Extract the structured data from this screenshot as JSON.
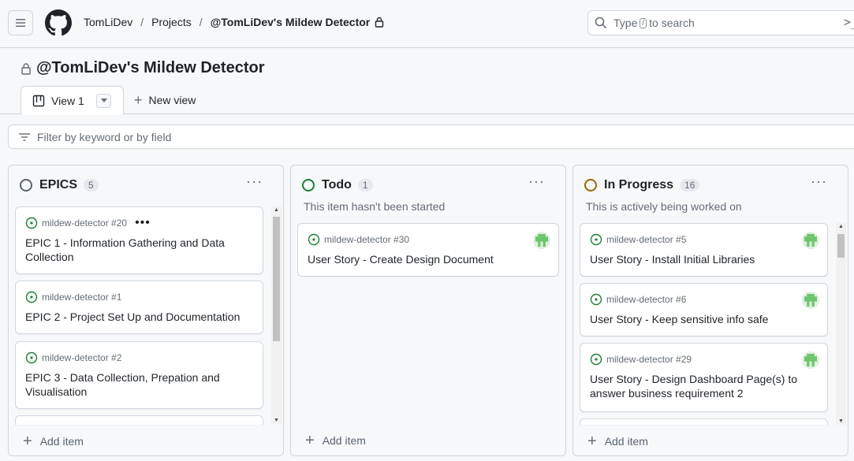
{
  "header": {
    "breadcrumbs": [
      "TomLiDev",
      "Projects",
      "@TomLiDev's Mildew Detector"
    ],
    "separator": "/",
    "search_placeholder_before": "Type",
    "search_key": "/",
    "search_placeholder_after": "to search",
    "terminal_glyph": ">_"
  },
  "project": {
    "title": "@TomLiDev's Mildew Detector",
    "tabs": [
      {
        "label": "View 1"
      }
    ],
    "new_view_label": "New view"
  },
  "filter": {
    "placeholder": "Filter by keyword or by field"
  },
  "columns": [
    {
      "title": "EPICS",
      "count": "5",
      "status_color": "#59636e",
      "description": "",
      "add_label": "Add item",
      "cards": [
        {
          "ref": "mildew-detector #20",
          "title": "EPIC 1 - Information Gathering and Data Collection",
          "menu": "•••"
        },
        {
          "ref": "mildew-detector #1",
          "title": "EPIC 2 - Project Set Up and Documentation"
        },
        {
          "ref": "mildew-detector #2",
          "title": "EPIC 3 - Data Collection, Prepation and Visualisation"
        }
      ]
    },
    {
      "title": "Todo",
      "count": "1",
      "status_color": "#1a7f37",
      "description": "This item hasn't been started",
      "add_label": "Add item",
      "cards": [
        {
          "ref": "mildew-detector #30",
          "title": "User Story - Create Design Document"
        }
      ]
    },
    {
      "title": "In Progress",
      "count": "16",
      "status_color": "#9a6700",
      "description": "This is actively being worked on",
      "add_label": "Add item",
      "cards": [
        {
          "ref": "mildew-detector #5",
          "title": "User Story - Install Initial Libraries"
        },
        {
          "ref": "mildew-detector #6",
          "title": "User Story - Keep sensitive info safe"
        },
        {
          "ref": "mildew-detector #29",
          "title": "User Story - Design Dashboard Page(s) to answer business requirement 2"
        }
      ]
    }
  ],
  "column_menu_glyph": "···",
  "colors": {
    "accent_open": "#1a7f37",
    "border": "#d0d7de",
    "muted": "#656d76"
  }
}
